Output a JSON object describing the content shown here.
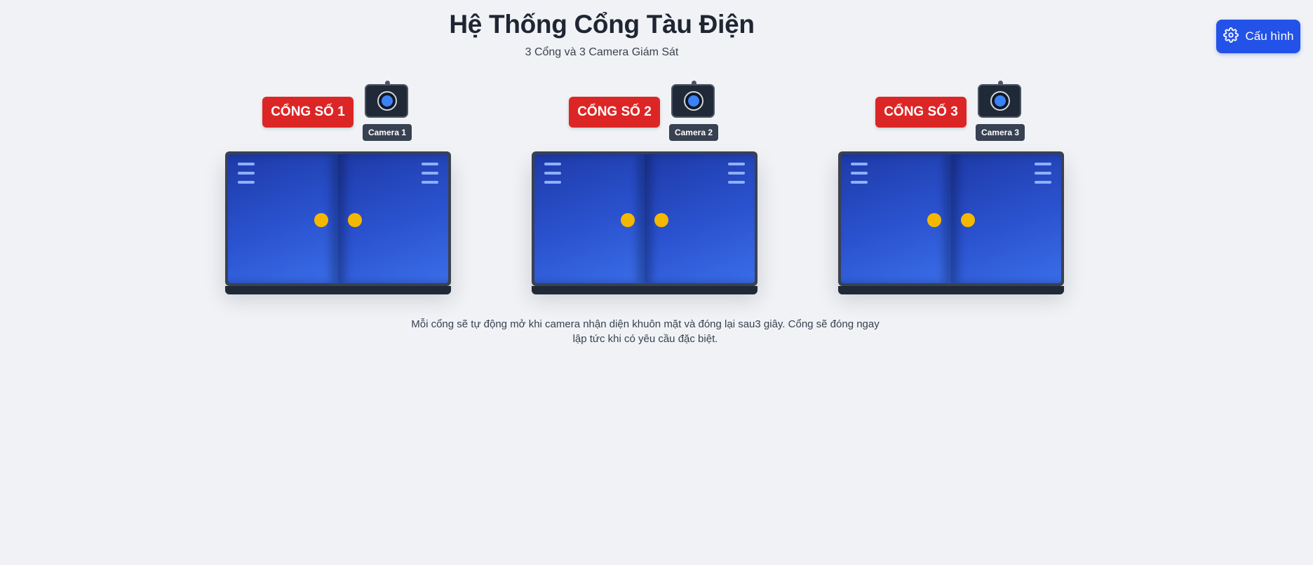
{
  "header": {
    "title": "Hệ Thống Cổng Tàu Điện",
    "subtitle": "3 Cổng và 3 Camera Giám Sát"
  },
  "config_button": {
    "label": "Cấu hình",
    "icon": "gear-icon",
    "color": "#2352e8"
  },
  "gates": [
    {
      "label": "CỔNG SỐ 1",
      "camera_label": "Camera 1"
    },
    {
      "label": "CỔNG SỐ 2",
      "camera_label": "Camera 2"
    },
    {
      "label": "CỔNG SỐ 3",
      "camera_label": "Camera 3"
    }
  ],
  "colors": {
    "gate_label": "#dc2626",
    "door": "#2b53d0",
    "knob": "#f5b800",
    "camera_lens": "#3b82f6"
  },
  "footer_note": "Mỗi cổng sẽ tự động mở khi camera nhận diện khuôn mặt và đóng lại sau3 giây. Cổng sẽ đóng ngay lập tức khi có yêu cầu đặc biệt."
}
